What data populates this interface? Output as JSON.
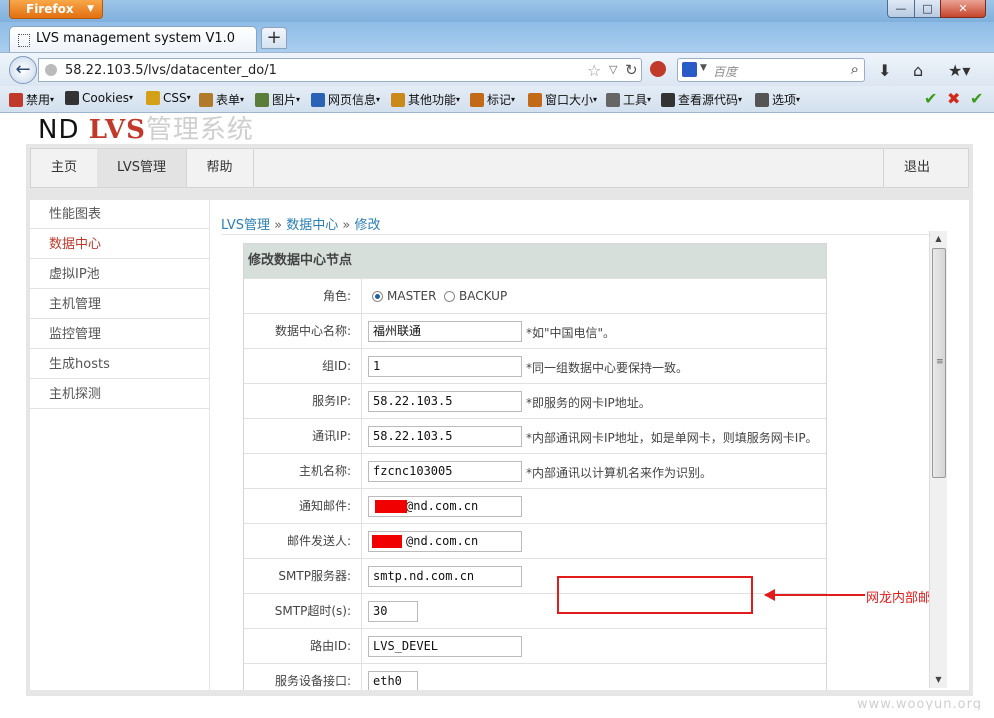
{
  "browser": {
    "menu_label": "Firefox",
    "tab_title": "LVS management system V1.0",
    "url": "58.22.103.5/lvs/datacenter_do/1",
    "search_placeholder": "百度",
    "win_min": "—",
    "win_max": "□",
    "win_close": "✕"
  },
  "bookmarks": [
    {
      "label": "禁用",
      "icon": "no-entry-icon",
      "color": "#c0392b"
    },
    {
      "label": "Cookies",
      "icon": "person-icon",
      "color": "#333333"
    },
    {
      "label": "CSS",
      "icon": "pencil-icon",
      "color": "#d4a017"
    },
    {
      "label": "表单",
      "icon": "clipboard-icon",
      "color": "#b07a2a"
    },
    {
      "label": "图片",
      "icon": "image-icon",
      "color": "#5a7d3a"
    },
    {
      "label": "网页信息",
      "icon": "info-icon",
      "color": "#2a62b5"
    },
    {
      "label": "其他功能",
      "icon": "book-icon",
      "color": "#c98a1a"
    },
    {
      "label": "标记",
      "icon": "pen-icon",
      "color": "#c36a1a"
    },
    {
      "label": "窗口大小",
      "icon": "resize-icon",
      "color": "#c36a1a"
    },
    {
      "label": "工具",
      "icon": "tools-icon",
      "color": "#666666"
    },
    {
      "label": "查看源代码",
      "icon": "source-icon",
      "color": "#333333"
    },
    {
      "label": "选项",
      "icon": "options-icon",
      "color": "#555555"
    }
  ],
  "app": {
    "logo_nd": "ND",
    "logo_lvs": "LVS",
    "logo_sys": "管理系统",
    "nav": [
      "主页",
      "LVS管理",
      "帮助"
    ],
    "logout": "退出",
    "sidebar": [
      "性能图表",
      "数据中心",
      "虚拟IP池",
      "主机管理",
      "监控管理",
      "生成hosts",
      "主机探测"
    ],
    "active_sidebar": "数据中心"
  },
  "breadcrumb": {
    "a": "LVS管理",
    "b": "数据中心",
    "c": "修改",
    "sep": "»"
  },
  "form": {
    "heading": "修改数据中心节点",
    "role_label": "角色:",
    "role_master": "MASTER",
    "role_backup": "BACKUP",
    "role_selected": "MASTER",
    "rows": [
      {
        "label": "数据中心名称:",
        "value": "福州联通",
        "hint": "*如\"中国电信\"。"
      },
      {
        "label": "组ID:",
        "value": "1",
        "hint": "*同一组数据中心要保持一致。"
      },
      {
        "label": "服务IP:",
        "value": "58.22.103.5",
        "hint": "*即服务的网卡IP地址。"
      },
      {
        "label": "通讯IP:",
        "value": "58.22.103.5",
        "hint": "*内部通讯网卡IP地址，如是单网卡，则填服务网卡IP。"
      },
      {
        "label": "主机名称:",
        "value": "fzcnc103005",
        "hint": "*内部通讯以计算机名来作为识别。"
      },
      {
        "label": "通知邮件:",
        "value": "@nd.com.cn",
        "hint": ""
      },
      {
        "label": "邮件发送人:",
        "value": "@nd.com.cn",
        "hint": ""
      },
      {
        "label": "SMTP服务器:",
        "value": "smtp.nd.com.cn",
        "hint": ""
      },
      {
        "label": "SMTP超时(s):",
        "value": "30",
        "hint": ""
      },
      {
        "label": "路由ID:",
        "value": "LVS_DEVEL",
        "hint": ""
      },
      {
        "label": "服务设备接口:",
        "value": "eth0",
        "hint": ""
      }
    ]
  },
  "annotation": {
    "text": "网龙内部邮件",
    "color": "#e21b1b"
  },
  "watermark": "www.wooyun.org"
}
